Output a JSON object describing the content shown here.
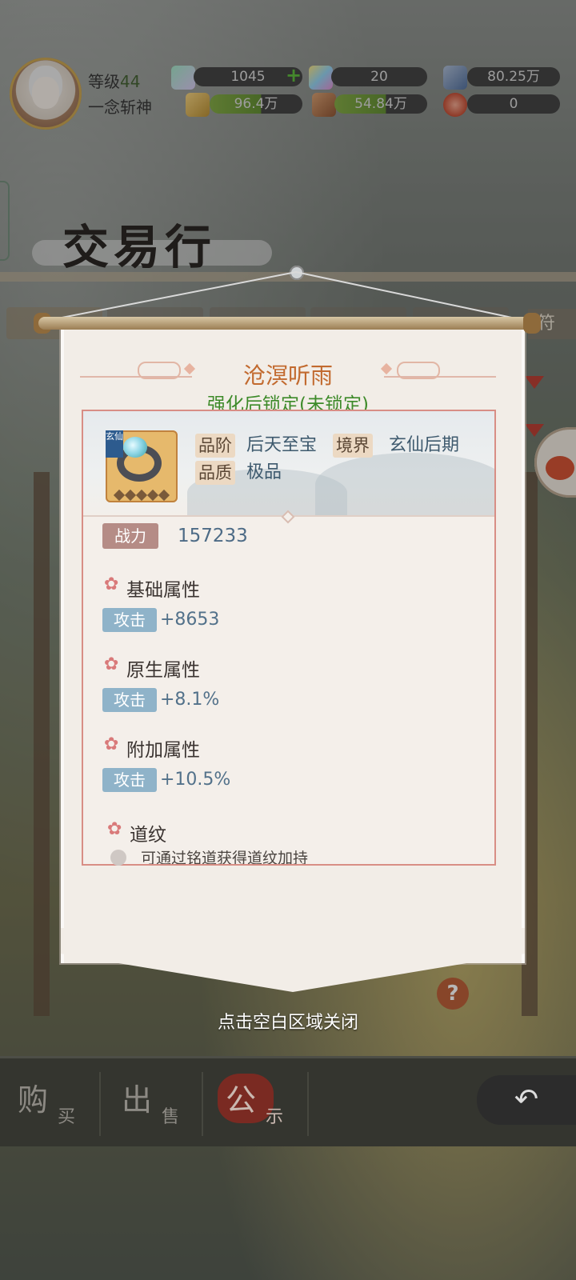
{
  "player": {
    "level_label": "等级",
    "level_value": "44",
    "name": "一念斩神"
  },
  "resources": {
    "spirit_stone": "1045",
    "crystal": "20",
    "ore": "80.25万",
    "gold": "96.4万",
    "meat": "54.84万",
    "token": "0"
  },
  "page": {
    "title": "交易行",
    "tab_partial": "符"
  },
  "popup": {
    "item_name": "沧溟听雨",
    "lock_status": "强化后锁定(未锁定)",
    "card_tag": "玄仙",
    "grade_label": "品阶",
    "grade_value": "后天至宝",
    "realm_label": "境界",
    "realm_value": "玄仙后期",
    "quality_label": "品质",
    "quality_value": "极品",
    "power_label": "战力",
    "power_value": "157233",
    "sections": {
      "base_title": "基础属性",
      "base_stat_name": "攻击",
      "base_stat_value": "+8653",
      "native_title": "原生属性",
      "native_stat_name": "攻击",
      "native_stat_value": "+8.1%",
      "extra_title": "附加属性",
      "extra_stat_name": "攻击",
      "extra_stat_value": "+10.5%",
      "dao_title": "道纹",
      "dao_hint": "可通过铭道获得道纹加持"
    },
    "close_hint": "点击空白区域关闭"
  },
  "bottom_nav": {
    "buy_big": "购",
    "buy_small": "买",
    "sell_big": "出",
    "sell_small": "售",
    "notice_big": "公",
    "notice_small": "示",
    "back_icon": "back-arrow-icon"
  },
  "colors": {
    "item_name": "#c26a2f",
    "lock_status": "#3d8a29",
    "detail_border": "#d88e85",
    "stat_tag": "#8fb3c9",
    "power_tag": "#b58c86"
  }
}
